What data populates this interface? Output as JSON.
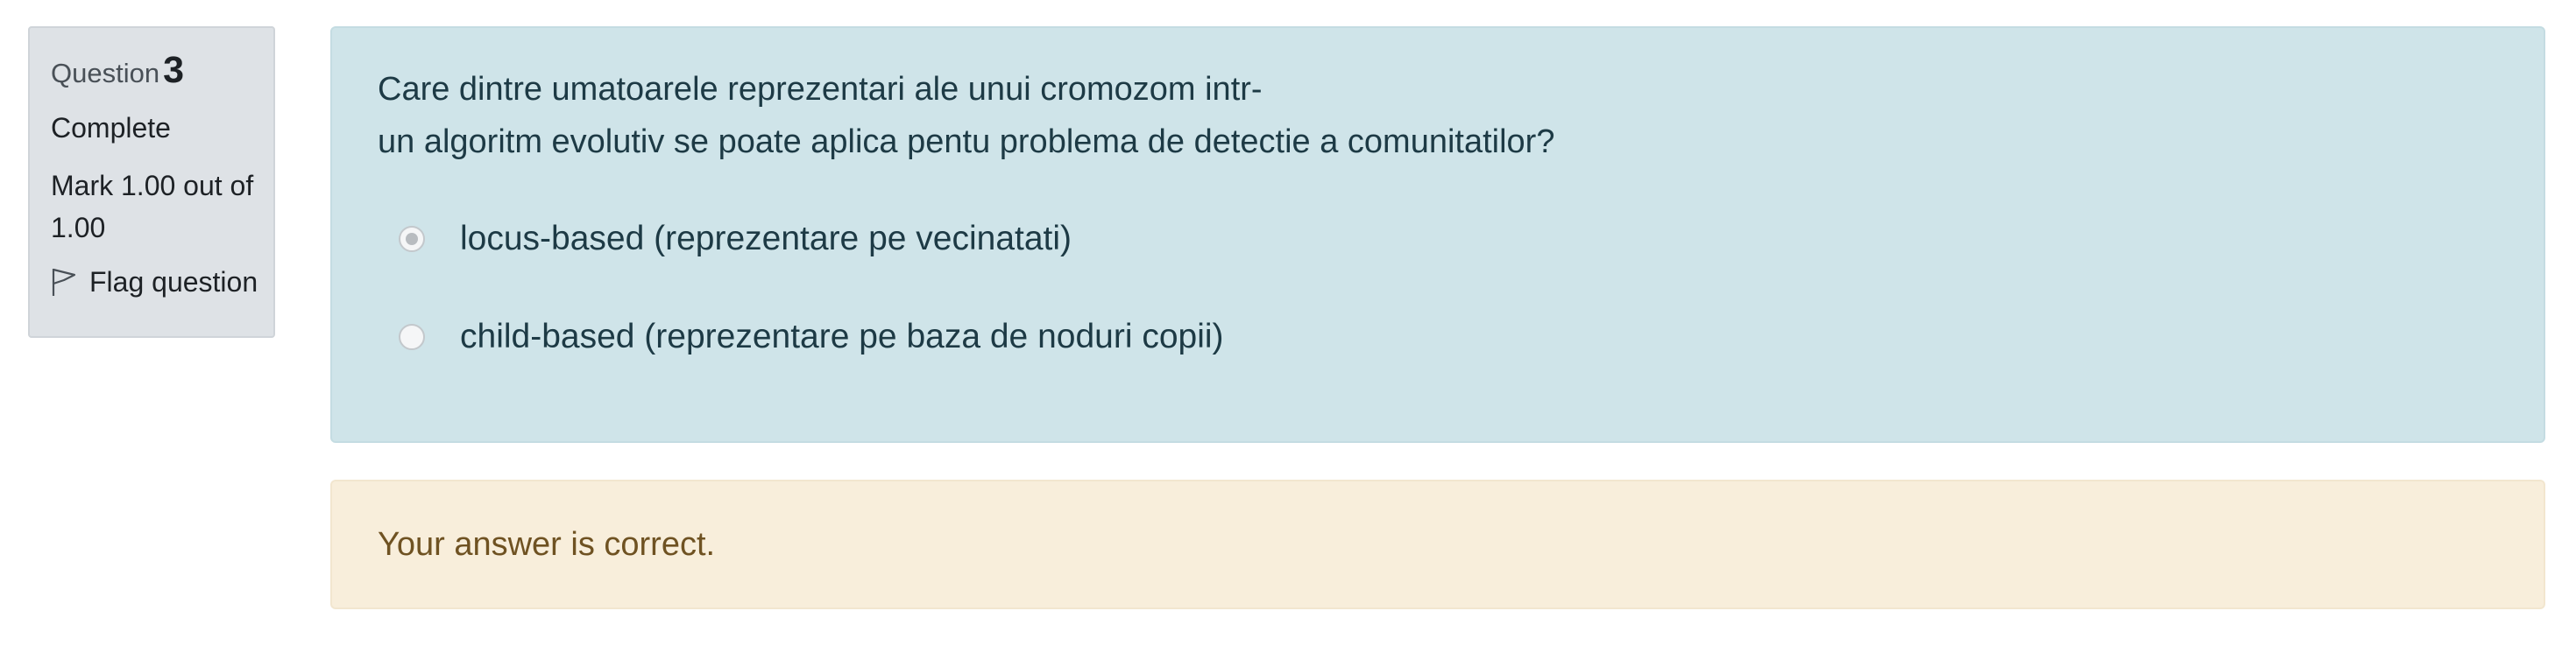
{
  "info": {
    "question_label": "Question",
    "question_number": "3",
    "state": "Complete",
    "grade": "Mark 1.00 out of 1.00",
    "flag_label": "Flag question"
  },
  "question": {
    "text_line1": "Care dintre umatoarele reprezentari ale unui cromozom intr-",
    "text_line2": "un algoritm evolutiv se poate aplica pentu problema de detectie a comunitatilor?",
    "answers": [
      {
        "label": "locus-based (reprezentare pe vecinatati)",
        "checked": true
      },
      {
        "label": "child-based (reprezentare pe baza de noduri copii)",
        "checked": false
      }
    ]
  },
  "feedback": {
    "text": "Your answer is correct."
  },
  "colors": {
    "info_bg": "#dee2e6",
    "question_bg": "#cfe4e9",
    "feedback_bg": "#f8eedb"
  }
}
